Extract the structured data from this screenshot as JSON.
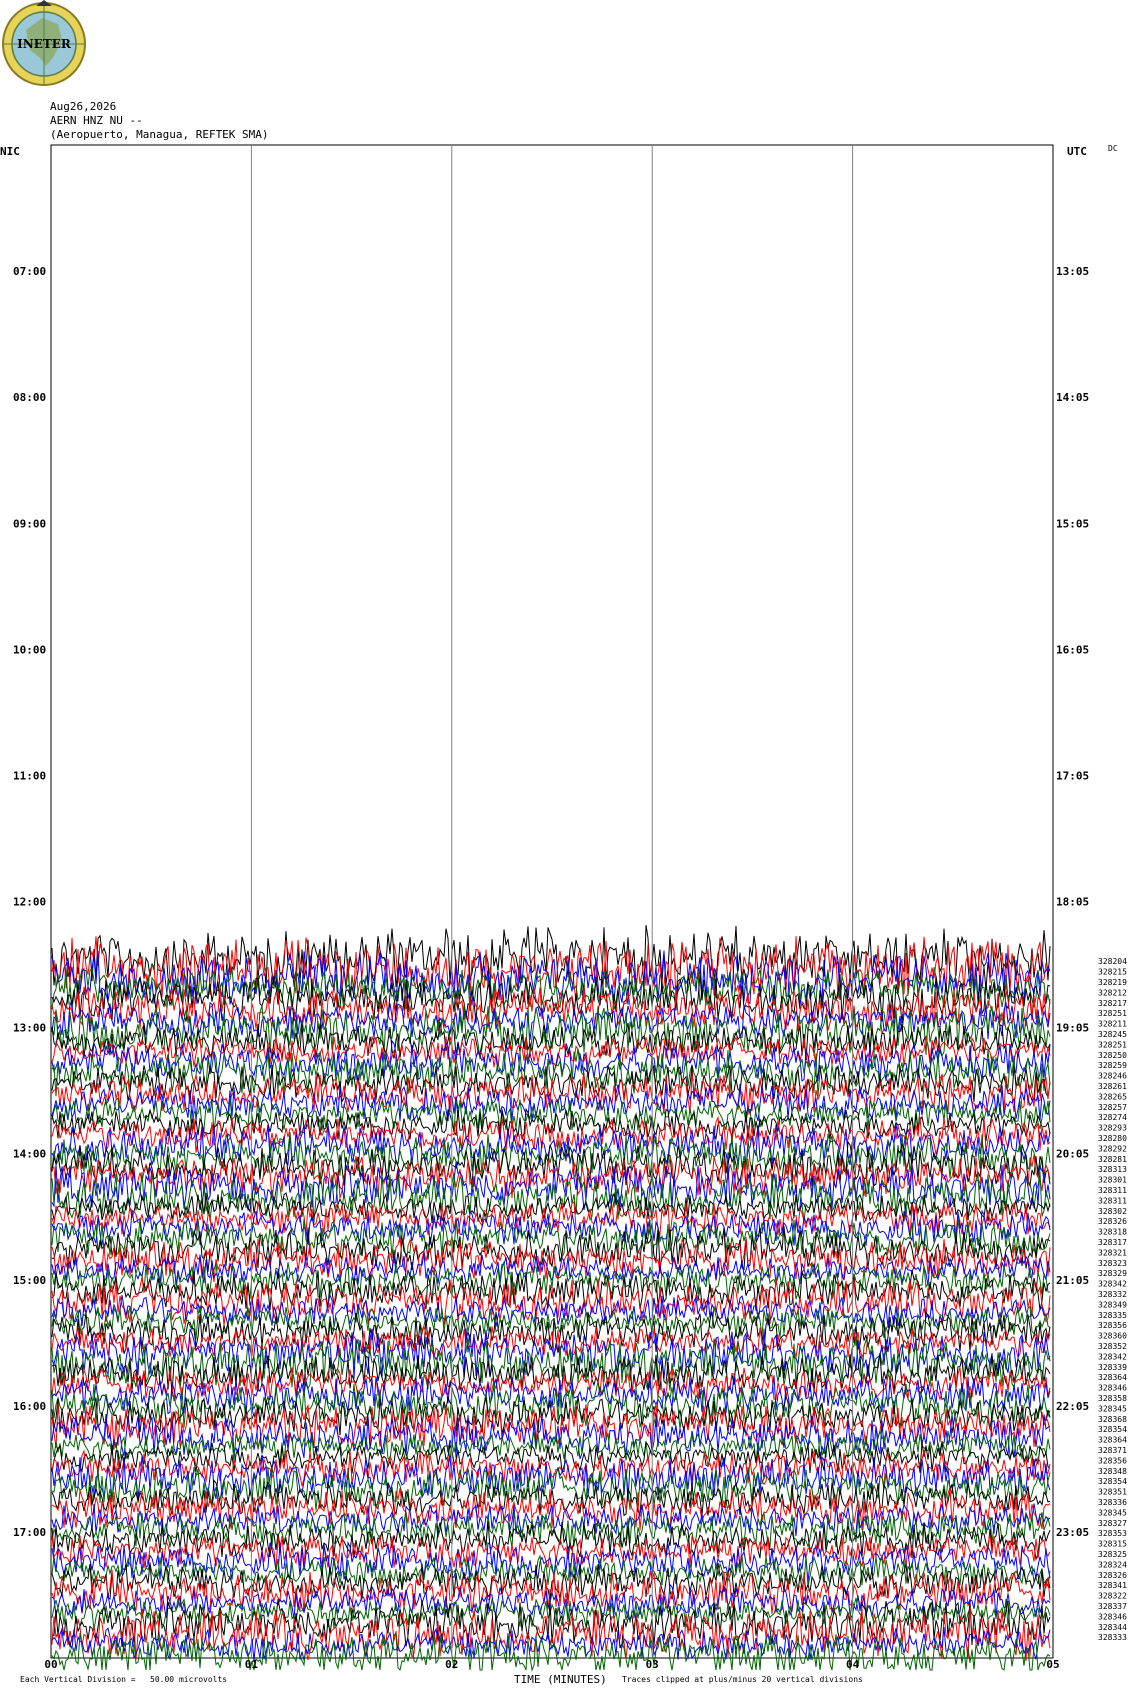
{
  "logo": {
    "text": "INETER",
    "colors": {
      "ring": "#e6d35a",
      "globe": "#9bc8d8",
      "land": "#8fb07a",
      "text": "#000000"
    }
  },
  "header": {
    "date": "Aug26,2026",
    "station": "AERN HNZ NU --",
    "location": "(Aeropuerto, Managua, REFTEK SMA)"
  },
  "left_label": "NIC",
  "right_label": "UTC",
  "dc_label": "DC",
  "footer": {
    "scale": "Each Vertical Division =   50.00 microvolts",
    "xtitle": "TIME (MINUTES)",
    "clip": "Traces clipped at plus/minus 20 vertical divisions"
  },
  "chart_data": {
    "type": "line",
    "title": "",
    "xlabel": "TIME (MINUTES)",
    "x_ticks": [
      "00",
      "01",
      "02",
      "03",
      "04",
      "05"
    ],
    "xlim": [
      0,
      5
    ],
    "left_hour_labels": [
      "07:00",
      "08:00",
      "09:00",
      "10:00",
      "11:00",
      "12:00",
      "13:00",
      "14:00",
      "15:00",
      "16:00",
      "17:00"
    ],
    "right_hour_labels": [
      "13:05",
      "14:05",
      "15:05",
      "16:05",
      "17:05",
      "18:05",
      "19:05",
      "20:05",
      "21:05",
      "22:05",
      "23:05"
    ],
    "first_hour": 6,
    "last_hour": 18,
    "data_start_hour": 12.45,
    "grid": true,
    "trace_colors": [
      "#000000",
      "#ff0000",
      "#0000ff",
      "#006400"
    ],
    "dc_offsets": [
      "328204",
      "328215",
      "328219",
      "328212",
      "328217",
      "328251",
      "328211",
      "328245",
      "328251",
      "328250",
      "328259",
      "328246",
      "328261",
      "328265",
      "328257",
      "328274",
      "328293",
      "328280",
      "328292",
      "328281",
      "328313",
      "328301",
      "328311",
      "328311",
      "328302",
      "328326",
      "328318",
      "328317",
      "328321",
      "328323",
      "328329",
      "328342",
      "328332",
      "328349",
      "328335",
      "328356",
      "328360",
      "328352",
      "328342",
      "328339",
      "328364",
      "328346",
      "328358",
      "328345",
      "328368",
      "328354",
      "328364",
      "328371",
      "328356",
      "328348",
      "328354",
      "328351",
      "328336",
      "328345",
      "328327",
      "328353",
      "328315",
      "328325",
      "328324",
      "328326",
      "328341",
      "328322",
      "328337",
      "328346",
      "328344",
      "328333"
    ]
  }
}
